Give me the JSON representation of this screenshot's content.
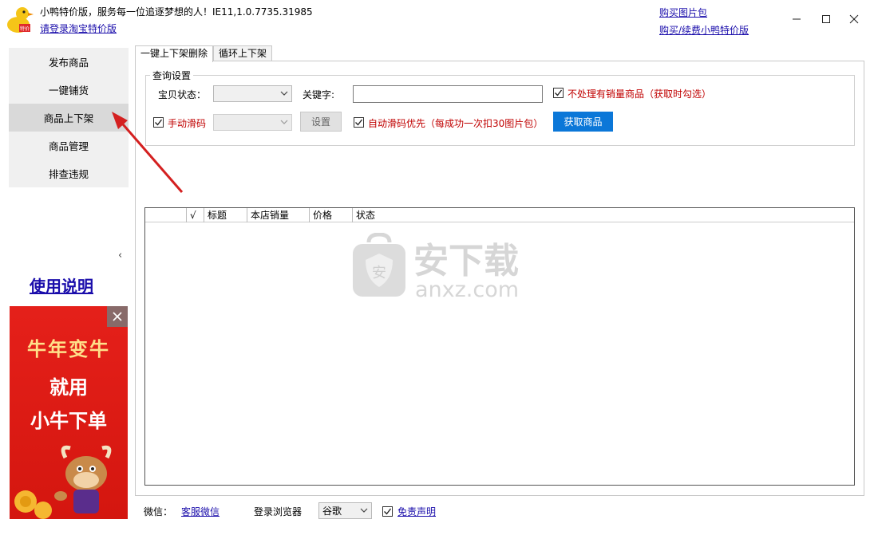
{
  "titlebar": {
    "app_title": "小鸭特价版，服务每一位追逐梦想的人！IE11,1.0.7735.31985",
    "login_link": "请登录淘宝特价版",
    "buy_pic_link": "购买图片包",
    "buy_renew_link": "购买/续费小鸭特价版",
    "logo_icon": "duck-logo-icon",
    "window_buttons": [
      "minimize-icon",
      "maximize-icon",
      "close-icon"
    ]
  },
  "sidebar": {
    "items": [
      {
        "label": "发布商品",
        "active": false
      },
      {
        "label": "一键铺货",
        "active": false
      },
      {
        "label": "商品上下架",
        "active": true
      },
      {
        "label": "商品管理",
        "active": false
      },
      {
        "label": "排查违规",
        "active": false
      }
    ],
    "collapse_glyph": "‹",
    "manual_link": "使用说明"
  },
  "ad": {
    "line1": "牛年变牛",
    "line2": "就用",
    "line3": "小牛下单",
    "close_icon": "close-icon",
    "colors": {
      "background": "#e5201a",
      "headline": "#ffe08a"
    }
  },
  "tabs": [
    {
      "label": "一键上下架删除",
      "active": true
    },
    {
      "label": "循环上下架",
      "active": false
    }
  ],
  "query": {
    "group_title": "查询设置",
    "status_label": "宝贝状态：",
    "status_value": "",
    "keyword_label": "关键字:",
    "keyword_value": "",
    "skip_sold_label": "不处理有销量商品（获取时勾选）",
    "skip_sold_checked": true,
    "manual_slide_label": "手动滑码",
    "manual_slide_checked": true,
    "manual_slide_value": "",
    "settings_button": "设置",
    "auto_slide_label": "自动滑码优先（每成功一次扣30图片包）",
    "auto_slide_checked": true,
    "fetch_button": "获取商品"
  },
  "table": {
    "columns": [
      "",
      "√",
      "标题",
      "本店销量",
      "价格",
      "状态"
    ],
    "rows": []
  },
  "watermark": {
    "text_cn": "安下载",
    "text_en": "anxz.com"
  },
  "footer": {
    "wechat_label": "微信：",
    "wechat_link": "客服微信",
    "browser_label": "登录浏览器",
    "browser_value": "谷歌",
    "disclaimer_checked": true,
    "disclaimer_link": "免责声明"
  },
  "colors": {
    "link": "#1a0dab",
    "warning_text": "#c00000",
    "primary_button": "#0b77d8",
    "annotation_arrow": "#d42020"
  }
}
